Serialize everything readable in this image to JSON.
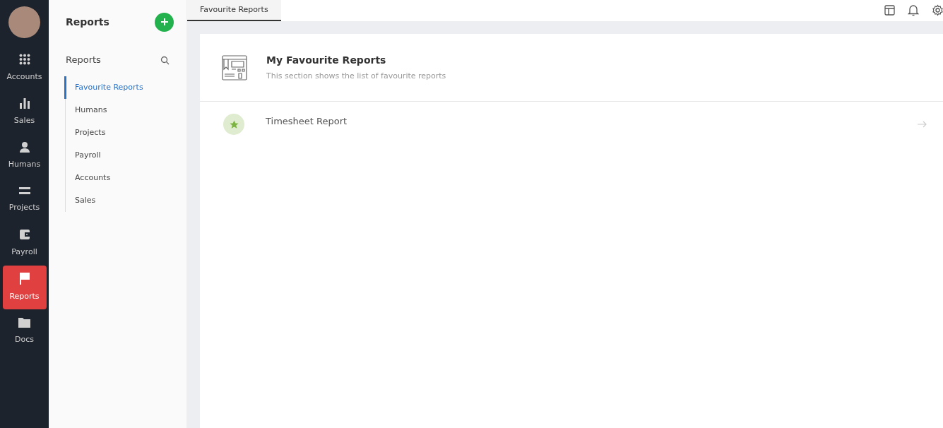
{
  "rail": {
    "items": [
      {
        "label": "Accounts",
        "selected": false
      },
      {
        "label": "Sales",
        "selected": false
      },
      {
        "label": "Humans",
        "selected": false
      },
      {
        "label": "Projects",
        "selected": false
      },
      {
        "label": "Payroll",
        "selected": false
      },
      {
        "label": "Reports",
        "selected": true
      },
      {
        "label": "Docs",
        "selected": false
      }
    ]
  },
  "sidebar": {
    "title": "Reports",
    "section": "Reports",
    "items": [
      {
        "label": "Favourite Reports",
        "selected": true
      },
      {
        "label": "Humans",
        "selected": false
      },
      {
        "label": "Projects",
        "selected": false
      },
      {
        "label": "Payroll",
        "selected": false
      },
      {
        "label": "Accounts",
        "selected": false
      },
      {
        "label": "Sales",
        "selected": false
      }
    ]
  },
  "tabs": [
    {
      "label": "Favourite Reports",
      "selected": true
    }
  ],
  "header": {
    "title": "My Favourite Reports",
    "subtitle": "This section shows the list of favourite reports"
  },
  "reports": [
    {
      "name": "Timesheet Report"
    }
  ]
}
